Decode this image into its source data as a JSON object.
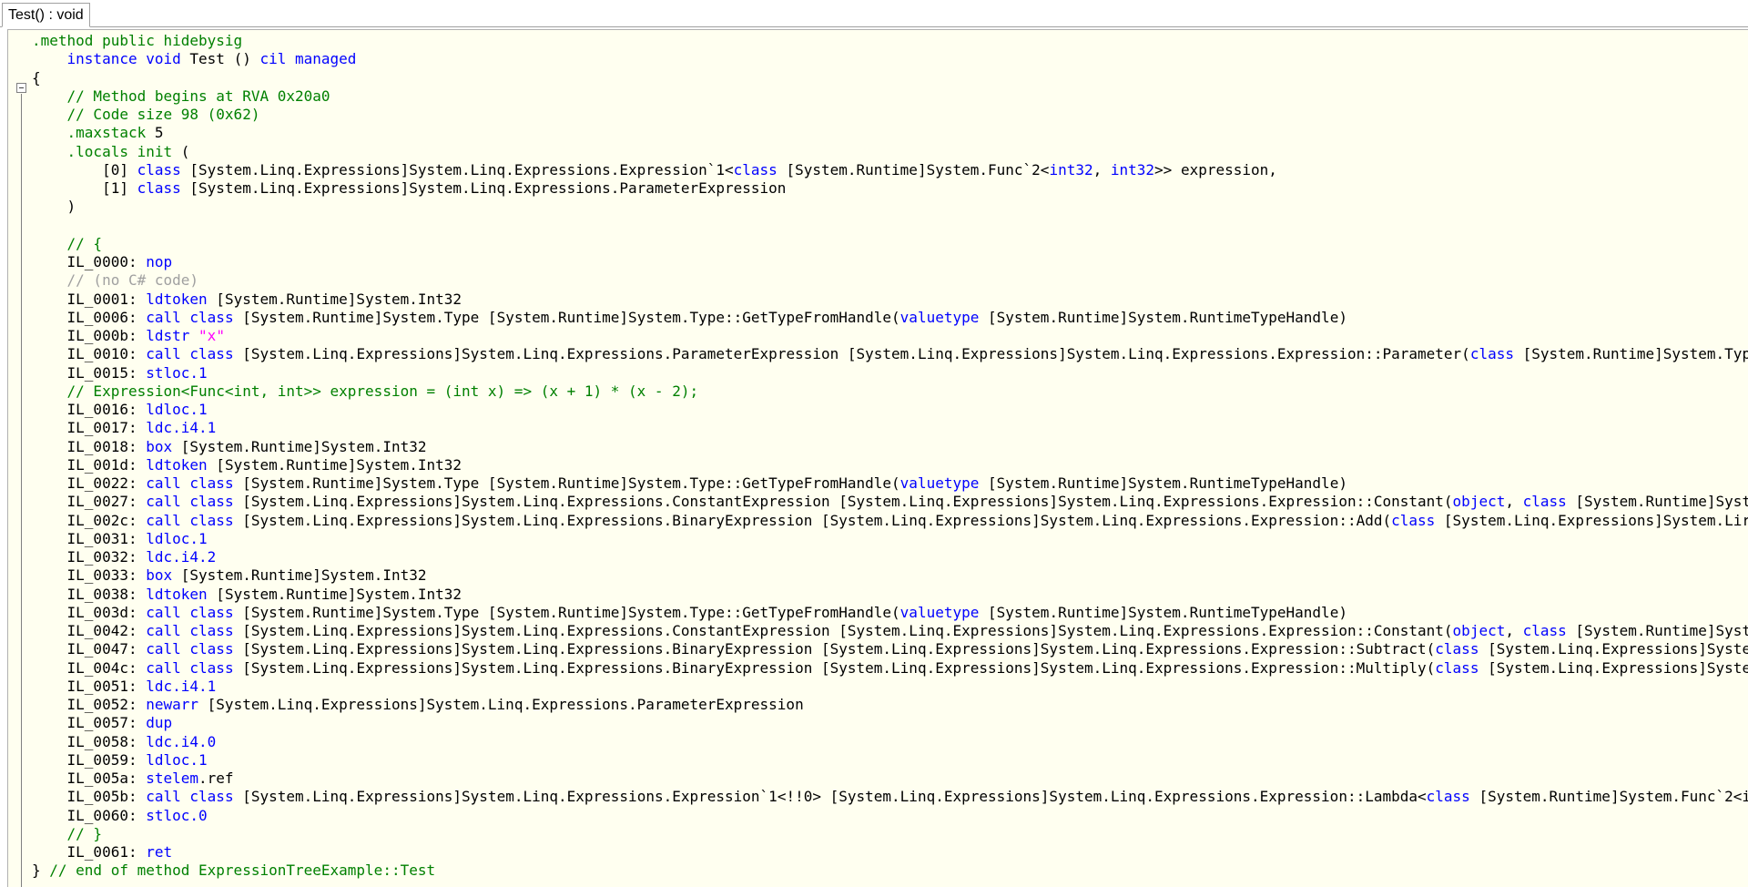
{
  "tab": {
    "label": "Test() : void"
  },
  "code": {
    "l1": {
      "a": ".method public hidebysig"
    },
    "l2": {
      "indent": "    ",
      "a": "instance void",
      "b": " Test () ",
      "c": "cil managed"
    },
    "l3": {
      "a": "{"
    },
    "l4": {
      "a": "    // Method begins at RVA 0x20a0"
    },
    "l5": {
      "a": "    // Code size 98 (0x62)"
    },
    "l6": {
      "a": "    .maxstack",
      "b": " 5"
    },
    "l7": {
      "a": "    .locals init",
      "b": " ("
    },
    "l8": {
      "a": "        [0] ",
      "b": "class",
      "c": " [System.Linq.Expressions]System.Linq.Expressions.Expression`1<",
      "d": "class",
      "e": " [System.Runtime]System.Func`2<",
      "f": "int32",
      "g": ", ",
      "h": "int32",
      "i": ">> expression,"
    },
    "l9": {
      "a": "        [1] ",
      "b": "class",
      "c": " [System.Linq.Expressions]System.Linq.Expressions.ParameterExpression"
    },
    "l10": {
      "a": "    )"
    },
    "l11": {
      "a": ""
    },
    "l12": {
      "a": "    // {"
    },
    "l13": {
      "a": "    IL_0000: ",
      "b": "nop"
    },
    "l14": {
      "a": "    // (no C# code)"
    },
    "l15": {
      "a": "    IL_0001: ",
      "b": "ldtoken",
      "c": " [System.Runtime]System.Int32"
    },
    "l16": {
      "a": "    IL_0006: ",
      "b": "call",
      "c": " ",
      "d": "class",
      "e": " [System.Runtime]System.Type [System.Runtime]System.Type::GetTypeFromHandle(",
      "f": "valuetype",
      "g": " [System.Runtime]System.RuntimeTypeHandle)"
    },
    "l17": {
      "a": "    IL_000b: ",
      "b": "ldstr",
      "c": " ",
      "d": "\"x\""
    },
    "l18": {
      "a": "    IL_0010: ",
      "b": "call",
      "c": " ",
      "d": "class",
      "e": " [System.Linq.Expressions]System.Linq.Expressions.ParameterExpression [System.Linq.Expressions]System.Linq.Expressions.Expression::Parameter(",
      "f": "class",
      "g": " [System.Runtime]System.Typ"
    },
    "l19": {
      "a": "    IL_0015: ",
      "b": "stloc.1"
    },
    "l20": {
      "a": "    // Expression<Func<int, int>> expression = (int x) => (x + 1) * (x - 2);"
    },
    "l21": {
      "a": "    IL_0016: ",
      "b": "ldloc.1"
    },
    "l22": {
      "a": "    IL_0017: ",
      "b": "ldc.i4.1"
    },
    "l23": {
      "a": "    IL_0018: ",
      "b": "box",
      "c": " [System.Runtime]System.Int32"
    },
    "l24": {
      "a": "    IL_001d: ",
      "b": "ldtoken",
      "c": " [System.Runtime]System.Int32"
    },
    "l25": {
      "a": "    IL_0022: ",
      "b": "call",
      "c": " ",
      "d": "class",
      "e": " [System.Runtime]System.Type [System.Runtime]System.Type::GetTypeFromHandle(",
      "f": "valuetype",
      "g": " [System.Runtime]System.RuntimeTypeHandle)"
    },
    "l26": {
      "a": "    IL_0027: ",
      "b": "call",
      "c": " ",
      "d": "class",
      "e": " [System.Linq.Expressions]System.Linq.Expressions.ConstantExpression [System.Linq.Expressions]System.Linq.Expressions.Expression::Constant(",
      "f": "object",
      "g": ", ",
      "h": "class",
      "i": " [System.Runtime]Syst"
    },
    "l27": {
      "a": "    IL_002c: ",
      "b": "call",
      "c": " ",
      "d": "class",
      "e": " [System.Linq.Expressions]System.Linq.Expressions.BinaryExpression [System.Linq.Expressions]System.Linq.Expressions.Expression::Add(",
      "f": "class",
      "g": " [System.Linq.Expressions]System.Lir"
    },
    "l28": {
      "a": "    IL_0031: ",
      "b": "ldloc.1"
    },
    "l29": {
      "a": "    IL_0032: ",
      "b": "ldc.i4.2"
    },
    "l30": {
      "a": "    IL_0033: ",
      "b": "box",
      "c": " [System.Runtime]System.Int32"
    },
    "l31": {
      "a": "    IL_0038: ",
      "b": "ldtoken",
      "c": " [System.Runtime]System.Int32"
    },
    "l32": {
      "a": "    IL_003d: ",
      "b": "call",
      "c": " ",
      "d": "class",
      "e": " [System.Runtime]System.Type [System.Runtime]System.Type::GetTypeFromHandle(",
      "f": "valuetype",
      "g": " [System.Runtime]System.RuntimeTypeHandle)"
    },
    "l33": {
      "a": "    IL_0042: ",
      "b": "call",
      "c": " ",
      "d": "class",
      "e": " [System.Linq.Expressions]System.Linq.Expressions.ConstantExpression [System.Linq.Expressions]System.Linq.Expressions.Expression::Constant(",
      "f": "object",
      "g": ", ",
      "h": "class",
      "i": " [System.Runtime]Syst"
    },
    "l34": {
      "a": "    IL_0047: ",
      "b": "call",
      "c": " ",
      "d": "class",
      "e": " [System.Linq.Expressions]System.Linq.Expressions.BinaryExpression [System.Linq.Expressions]System.Linq.Expressions.Expression::Subtract(",
      "f": "class",
      "g": " [System.Linq.Expressions]Syste"
    },
    "l35": {
      "a": "    IL_004c: ",
      "b": "call",
      "c": " ",
      "d": "class",
      "e": " [System.Linq.Expressions]System.Linq.Expressions.BinaryExpression [System.Linq.Expressions]System.Linq.Expressions.Expression::Multiply(",
      "f": "class",
      "g": " [System.Linq.Expressions]Syste"
    },
    "l36": {
      "a": "    IL_0051: ",
      "b": "ldc.i4.1"
    },
    "l37": {
      "a": "    IL_0052: ",
      "b": "newarr",
      "c": " [System.Linq.Expressions]System.Linq.Expressions.ParameterExpression"
    },
    "l38": {
      "a": "    IL_0057: ",
      "b": "dup"
    },
    "l39": {
      "a": "    IL_0058: ",
      "b": "ldc.i4.0"
    },
    "l40": {
      "a": "    IL_0059: ",
      "b": "ldloc.1"
    },
    "l41": {
      "a": "    IL_005a: ",
      "b": "stelem",
      "c": ".ref"
    },
    "l42": {
      "a": "    IL_005b: ",
      "b": "call",
      "c": " ",
      "d": "class",
      "e": " [System.Linq.Expressions]System.Linq.Expressions.Expression`1<!!0> [System.Linq.Expressions]System.Linq.Expressions.Expression::Lambda<",
      "f": "class",
      "g": " [System.Runtime]System.Func`2<i"
    },
    "l43": {
      "a": "    IL_0060: ",
      "b": "stloc.0"
    },
    "l44": {
      "a": "    // }"
    },
    "l45": {
      "a": "    IL_0061: ",
      "b": "ret"
    },
    "l46": {
      "a": "} ",
      "b": "// end of method ExpressionTreeExample::Test"
    }
  }
}
